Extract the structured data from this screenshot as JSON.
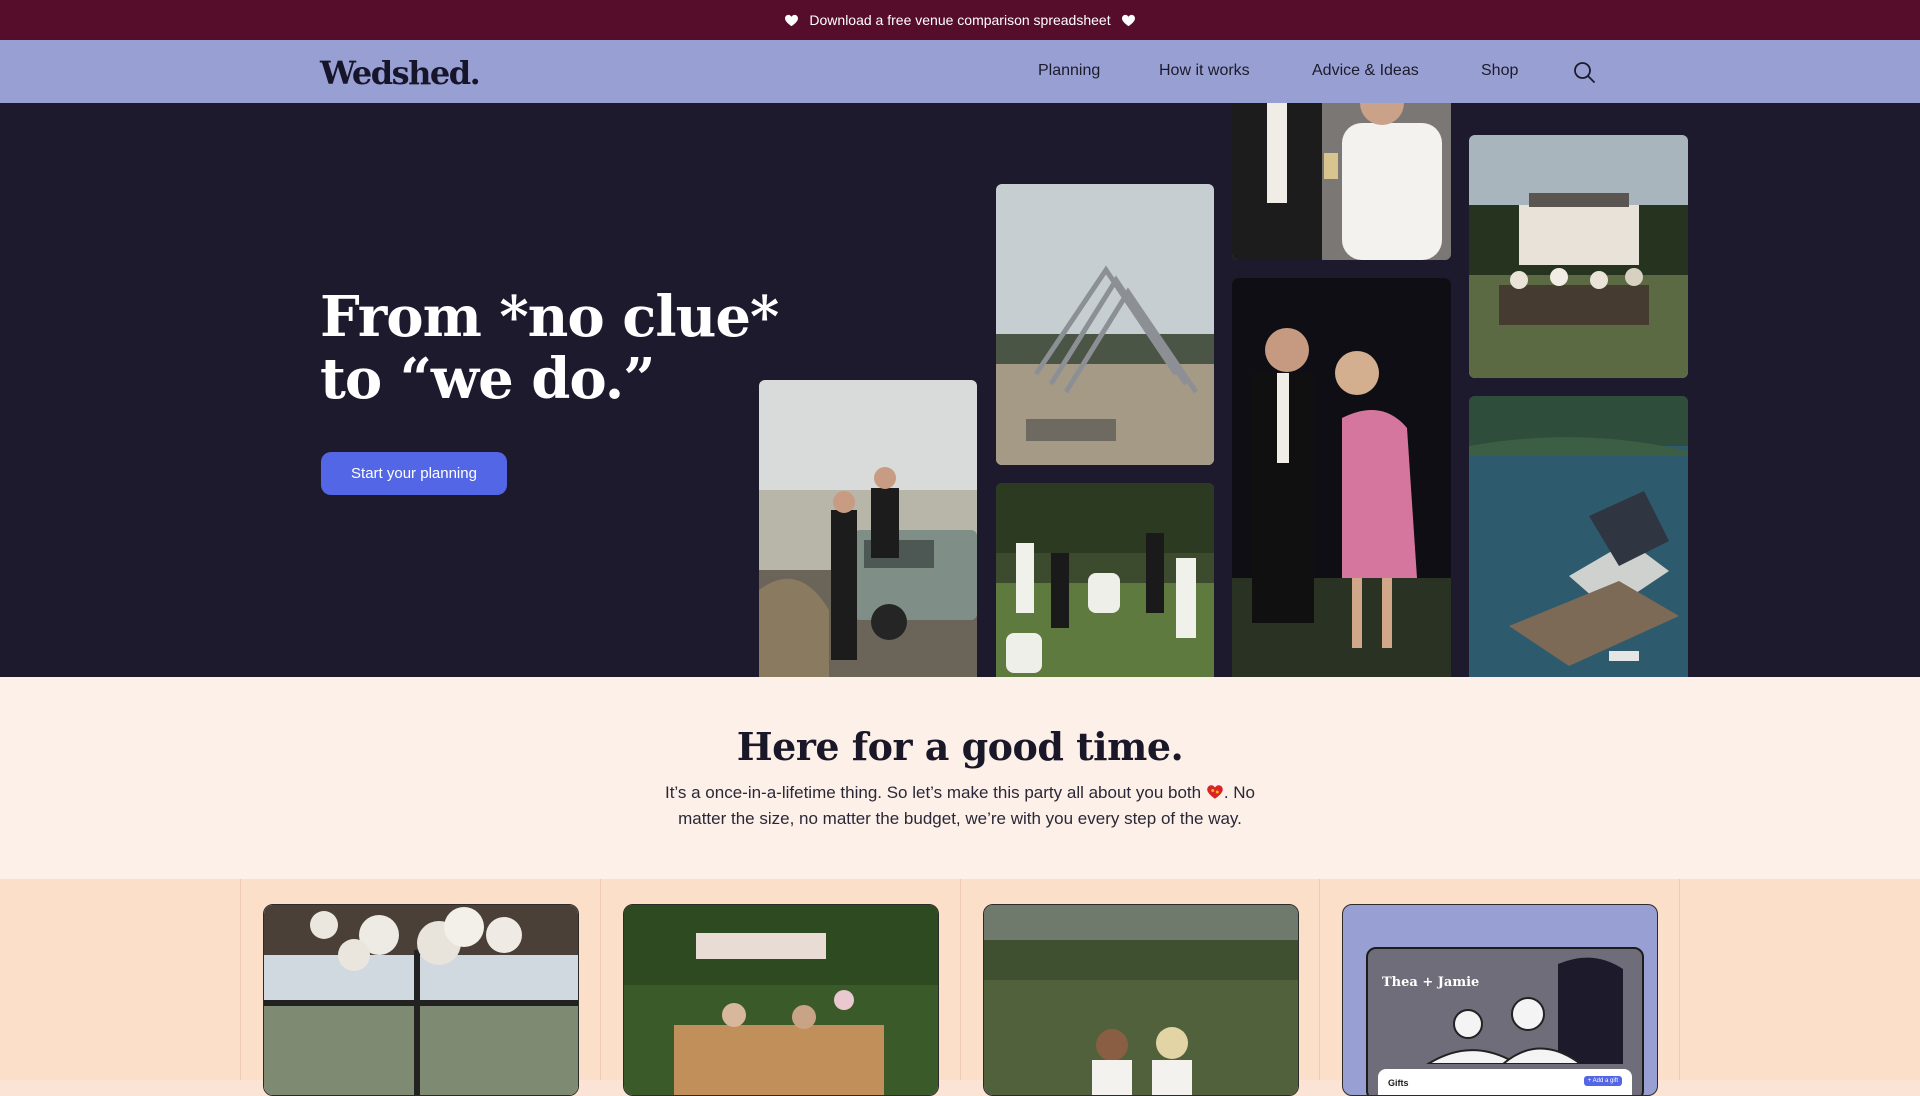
{
  "banner": {
    "text": "Download a free venue comparison spreadsheet",
    "icon": "heart-icon"
  },
  "nav": {
    "logo": "Wedshed.",
    "items": [
      "Planning",
      "How it works",
      "Advice & Ideas",
      "Shop"
    ],
    "search_icon": "search-icon"
  },
  "hero": {
    "headline_line1": "From *no clue*",
    "headline_line2": "to “we do.”",
    "cta_label": "Start your planning"
  },
  "intro": {
    "title": "Here for a good time.",
    "text_before": "It’s a once-in-a-lifetime thing. So let’s make this party all about you both",
    "text_after": ". No matter the size, no matter the budget, we’re with you every step of the way."
  },
  "cards": {
    "card4": {
      "names": "Thea + Jamie",
      "gifts_label": "Gifts",
      "add_button": "+ Add a gift"
    }
  },
  "colors": {
    "banner_bg": "#560d2c",
    "nav_bg": "#98a0d3",
    "hero_bg": "#1d1a2d",
    "cta_bg": "#5366e6",
    "intro_bg": "#fdf0e8",
    "cards_bg": "#fbdfc9"
  }
}
